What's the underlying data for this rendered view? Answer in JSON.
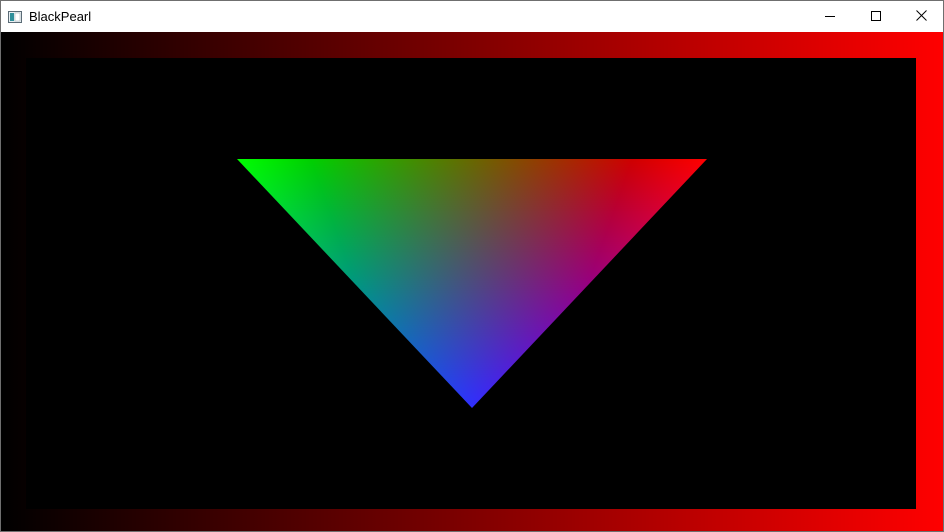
{
  "window": {
    "title": "BlackPearl",
    "icon": "app-window-icon",
    "controls": [
      {
        "name": "minimize",
        "icon": "minimize-icon"
      },
      {
        "name": "maximize",
        "icon": "maximize-icon"
      },
      {
        "name": "close",
        "icon": "close-icon"
      }
    ]
  },
  "scene": {
    "background_color": "#000000",
    "frame_corner_colors": {
      "top_left": "#000000",
      "top_right": "#ff0000",
      "bottom_left": "#00ff00",
      "bottom_right": "#ffff00"
    },
    "triangle_vertex_colors": {
      "top_left": "#00ff00",
      "top_right": "#ff0000",
      "bottom": "#0000ff"
    }
  }
}
